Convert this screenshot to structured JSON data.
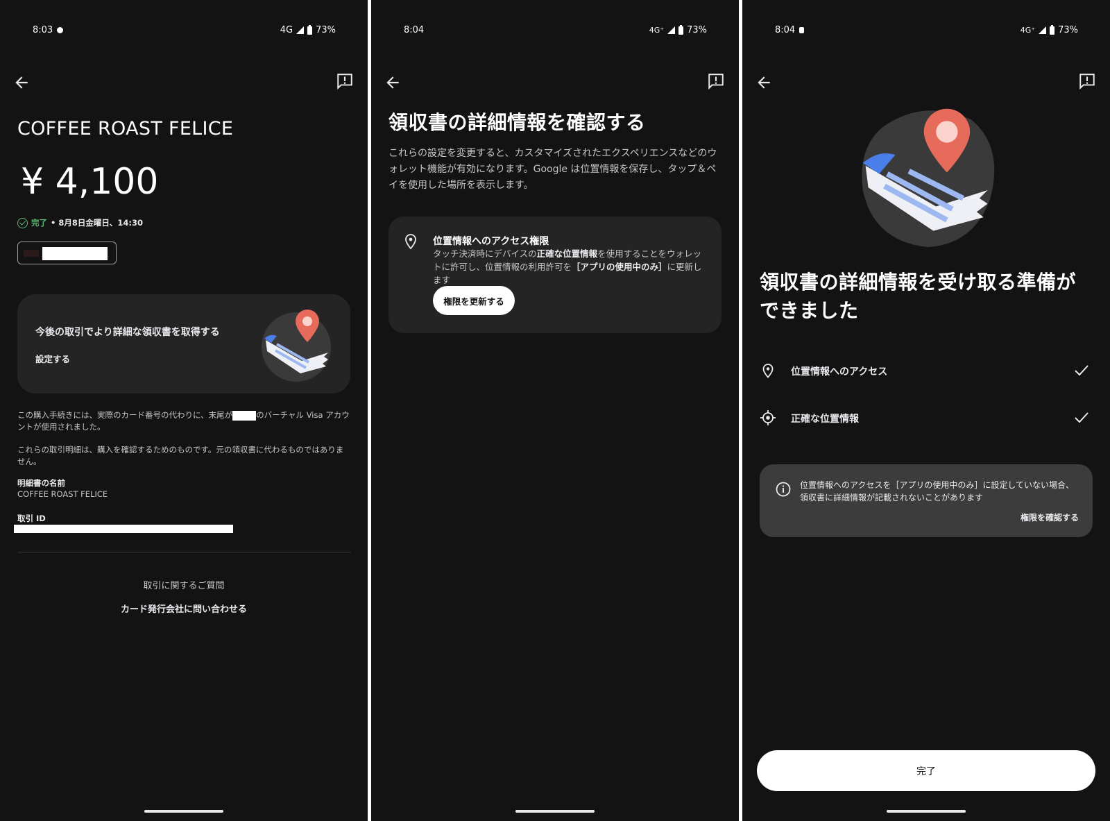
{
  "screen1": {
    "status": {
      "time": "8:03",
      "network": "4G",
      "battery": "73%"
    },
    "merchant": "COFFEE ROAST FELICE",
    "amount": "¥ 4,100",
    "status_done": "完了",
    "status_detail": "• 8月8日金曜日、14:30",
    "promo": {
      "title": "今後の取引でより詳細な領収書を取得する",
      "link": "設定する"
    },
    "fine1_a": "この購入手続きには、実際のカード番号の代わりに、末尾が",
    "fine1_b": "のバーチャル Visa アカウントが使用されました。",
    "fine2": "これらの取引明細は、購入を確認するためのものです。元の領収書に代わるものではありません。",
    "statement_label": "明細書の名前",
    "statement_value": "COFFEE ROAST FELICE",
    "txn_label": "取引 ID",
    "question": "取引に関するご質問",
    "contact": "カード発行会社に問い合わせる"
  },
  "screen2": {
    "status": {
      "time": "8:04",
      "network": "4G⁺",
      "battery": "73%"
    },
    "title": "領収書の詳細情報を確認する",
    "desc": "これらの設定を変更すると、カスタマイズされたエクスペリエンスなどのウォレット機能が有効になります。Google は位置情報を保存し、タップ＆ペイを使用した場所を表示します。",
    "perm_title": "位置情報へのアクセス権限",
    "perm_desc_1": "タッチ決済時にデバイスの",
    "perm_desc_bold1": "正確な位置情報",
    "perm_desc_2": "を使用することをウォレットに許可し、位置情報の利用許可を",
    "perm_desc_bold2": "［アプリの使用中のみ］",
    "perm_desc_3": "に更新します",
    "perm_button": "権限を更新する"
  },
  "screen3": {
    "status": {
      "time": "8:04",
      "network": "4G⁺",
      "battery": "73%"
    },
    "title": "領収書の詳細情報を受け取る準備ができました",
    "row1": "位置情報へのアクセス",
    "row2": "正確な位置情報",
    "info_text": "位置情報へのアクセスを［アプリの使用中のみ］に設定していない場合、領収書に詳細情報が記載されないことがあります",
    "info_link": "権限を確認する",
    "done_button": "完了"
  },
  "colors": {
    "background": "#131313",
    "card": "#242424",
    "success": "#5bb974",
    "pin": "#e66b5b"
  }
}
